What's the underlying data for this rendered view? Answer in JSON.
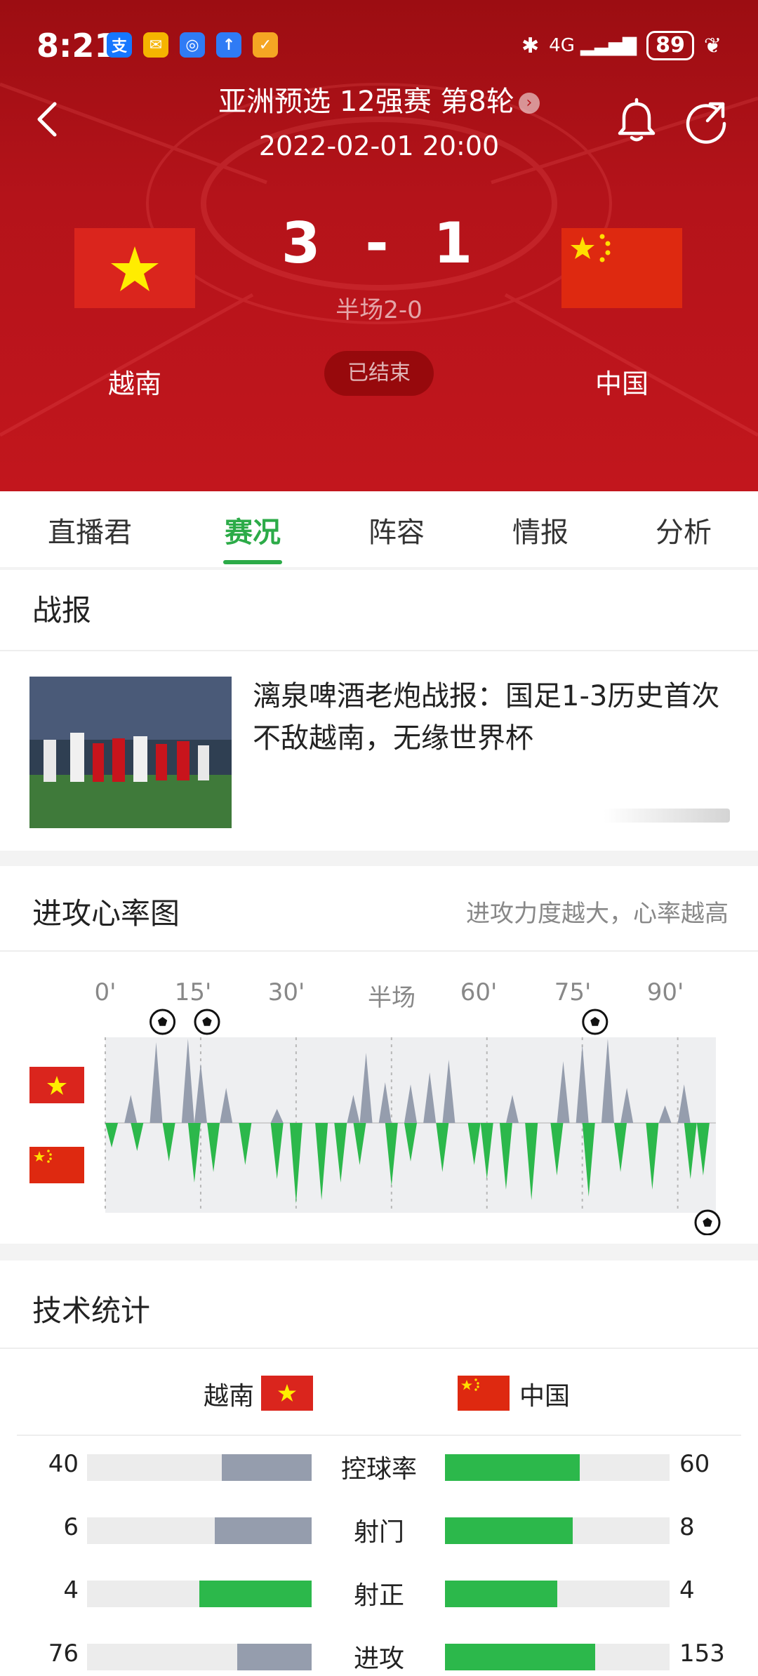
{
  "status_bar": {
    "time": "8:21",
    "battery": "89",
    "network": "4G"
  },
  "header": {
    "competition": "亚洲预选 12强赛 第8轮",
    "datetime": "2022-02-01 20:00",
    "home_team": "越南",
    "away_team": "中国",
    "home_score": "3",
    "away_score": "1",
    "separator": "-",
    "halftime": "半场2-0",
    "status": "已结束"
  },
  "tabs": [
    {
      "label": "直播君"
    },
    {
      "label": "赛况",
      "active": true
    },
    {
      "label": "阵容"
    },
    {
      "label": "情报"
    },
    {
      "label": "分析"
    }
  ],
  "report": {
    "section_title": "战报",
    "headline": "漓泉啤酒老炮战报：国足1-3历史首次不敌越南，无缘世界杯"
  },
  "heart_rate": {
    "section_title": "进攻心率图",
    "subtitle": "进攻力度越大，心率越高",
    "axis_labels": [
      "0'",
      "15'",
      "30'",
      "半场",
      "60'",
      "75'",
      "90'"
    ],
    "home_goal_minutes": [
      9,
      16,
      77
    ],
    "away_goal_minutes": [
      95
    ]
  },
  "stats": {
    "section_title": "技术统计",
    "home_team": "越南",
    "away_team": "中国",
    "rows": [
      {
        "name": "控球率",
        "home": "40",
        "away": "60",
        "home_ratio": 0.4,
        "away_ratio": 0.6,
        "home_color": "#959dad"
      },
      {
        "name": "射门",
        "home": "6",
        "away": "8",
        "home_ratio": 0.43,
        "away_ratio": 0.57,
        "home_color": "#959dad"
      },
      {
        "name": "射正",
        "home": "4",
        "away": "4",
        "home_ratio": 0.5,
        "away_ratio": 0.5,
        "home_color": "#2cb84b"
      },
      {
        "name": "进攻",
        "home": "76",
        "away": "153",
        "home_ratio": 0.33,
        "away_ratio": 0.67,
        "home_color": "#959dad"
      }
    ]
  },
  "colors": {
    "accent": "#2cab48",
    "header_red": "#b4131a",
    "home_bar": "#959dad",
    "away_bar": "#2cb84b"
  }
}
